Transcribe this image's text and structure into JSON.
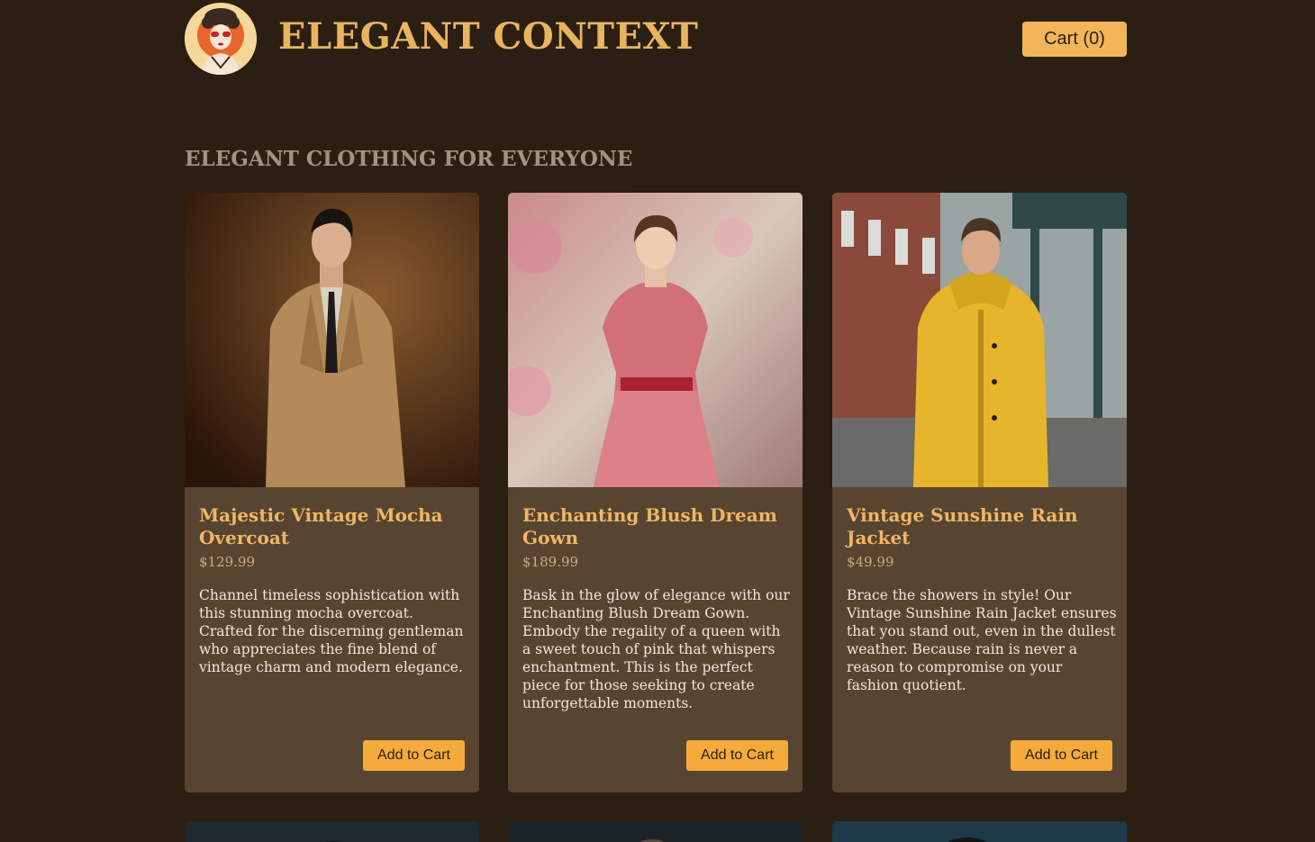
{
  "header": {
    "brand": "ELEGANT CONTEXT",
    "cart_label": "Cart (0)",
    "logo_icon": "vintage-woman-logo-icon"
  },
  "section": {
    "title": "ELEGANT CLOTHING FOR EVERYONE"
  },
  "products": [
    {
      "name": "Majestic Vintage Mocha Overcoat",
      "price": "$129.99",
      "description": "Channel timeless sophistication with this stunning mocha overcoat. Crafted for the discerning gentleman who appreciates the fine blend of vintage charm and modern elegance.",
      "button": "Add to Cart"
    },
    {
      "name": "Enchanting Blush Dream Gown",
      "price": "$189.99",
      "description": "Bask in the glow of elegance with our Enchanting Blush Dream Gown. Embody the regality of a queen with a sweet touch of pink that whispers enchantment. This is the perfect piece for those seeking to create unforgettable moments.",
      "button": "Add to Cart"
    },
    {
      "name": "Vintage Sunshine Rain Jacket",
      "price": "$49.99",
      "description": "Brace the showers in style! Our Vintage Sunshine Rain Jacket ensures that you stand out, even in the dullest weather. Because rain is never a reason to compromise on your fashion quotient.",
      "button": "Add to Cart"
    }
  ],
  "colors": {
    "background": "#2b1f13",
    "card": "#574531",
    "accent": "#f4ab3c",
    "title": "#e9b45f"
  }
}
